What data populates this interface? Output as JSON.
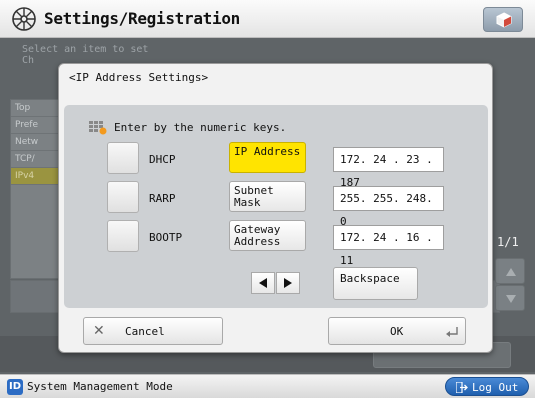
{
  "header": {
    "title": "Settings/Registration",
    "title_icon": "settings-wheel-icon",
    "corner_icon": "cube-icon"
  },
  "background": {
    "prompt_line1": "Select an item to set",
    "prompt_line2": "Ch",
    "list_items": [
      "Top",
      "Prefe",
      "Netw",
      "TCP/",
      "IPv4"
    ],
    "page_indicator": "1/1"
  },
  "dialog": {
    "title": "<IP Address Settings>",
    "instruction": "Enter by the numeric keys.",
    "methods": [
      {
        "label": "DHCP"
      },
      {
        "label": "RARP"
      },
      {
        "label": "BOOTP"
      }
    ],
    "fields": [
      {
        "label": "IP Address",
        "value": "172. 24 . 23 . 187",
        "active": true
      },
      {
        "label": "Subnet Mask",
        "value": "255. 255. 248. 0",
        "active": false
      },
      {
        "label": "Gateway Address",
        "value": "172. 24 . 16 . 11",
        "active": false
      }
    ],
    "backspace_label": "Backspace",
    "cancel_label": "Cancel",
    "ok_label": "OK"
  },
  "status": {
    "mode_icon_text": "ID",
    "mode_text": "System Management Mode",
    "logout_label": "Log Out"
  },
  "colors": {
    "active_field": "#ffe400",
    "logout_button": "#2f72c4"
  }
}
